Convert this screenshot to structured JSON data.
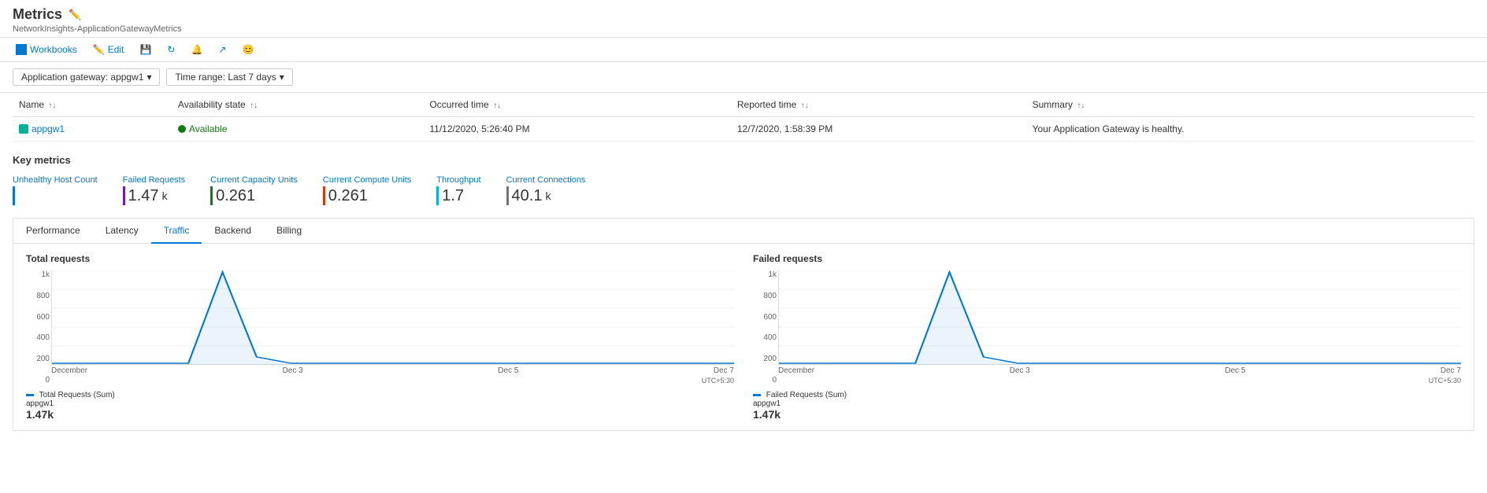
{
  "header": {
    "title": "Metrics",
    "breadcrumb": "NetworkInsights-ApplicationGatewayMetrics",
    "edit_icon": "✏️"
  },
  "toolbar": {
    "workbooks_label": "Workbooks",
    "edit_label": "Edit",
    "save_icon": "💾",
    "refresh_icon": "↻",
    "alert_icon": "🔔",
    "share_icon": "↗",
    "emoji_icon": "😊"
  },
  "filters": {
    "gateway_label": "Application gateway: appgw1",
    "time_range_label": "Time range: Last 7 days"
  },
  "table": {
    "columns": [
      {
        "label": "Name",
        "sort": true
      },
      {
        "label": "Availability state",
        "sort": true
      },
      {
        "label": "Occurred time",
        "sort": true
      },
      {
        "label": "Reported time",
        "sort": true
      },
      {
        "label": "Summary",
        "sort": true
      }
    ],
    "rows": [
      {
        "name": "appgw1",
        "availability": "Available",
        "occurred": "11/12/2020, 5:26:40 PM",
        "reported": "12/7/2020, 1:58:39 PM",
        "summary": "Your Application Gateway is healthy."
      }
    ]
  },
  "key_metrics": {
    "title": "Key metrics",
    "items": [
      {
        "label": "Unhealthy Host Count",
        "value": "",
        "bar_class": "bar-blue"
      },
      {
        "label": "Failed Requests",
        "value": "1.47",
        "suffix": "k",
        "bar_class": "bar-purple"
      },
      {
        "label": "Current Capacity Units",
        "value": "0.261",
        "suffix": "",
        "bar_class": "bar-green"
      },
      {
        "label": "Current Compute Units",
        "value": "0.261",
        "suffix": "",
        "bar_class": "bar-orange"
      },
      {
        "label": "Throughput",
        "value": "1.7",
        "suffix": "",
        "bar_class": "bar-lightblue"
      },
      {
        "label": "Current Connections",
        "value": "40.1",
        "suffix": "k",
        "bar_class": "bar-gray"
      }
    ]
  },
  "tabs": {
    "items": [
      {
        "label": "Performance",
        "active": false
      },
      {
        "label": "Latency",
        "active": false
      },
      {
        "label": "Traffic",
        "active": true
      },
      {
        "label": "Backend",
        "active": false
      },
      {
        "label": "Billing",
        "active": false
      }
    ]
  },
  "charts": {
    "total_requests": {
      "title": "Total requests",
      "y_labels": [
        "1k",
        "800",
        "600",
        "400",
        "200",
        "0"
      ],
      "x_labels": [
        "December",
        "Dec 3",
        "Dec 5",
        "Dec 7"
      ],
      "utc": "UTC+5:30",
      "legend_label": "Total Requests (Sum)",
      "legend_sub": "appgw1",
      "legend_value": "1.47",
      "legend_suffix": "k"
    },
    "failed_requests": {
      "title": "Failed requests",
      "y_labels": [
        "1k",
        "800",
        "600",
        "400",
        "200",
        "0"
      ],
      "x_labels": [
        "December",
        "Dec 3",
        "Dec 5",
        "Dec 7"
      ],
      "utc": "UTC+5:30",
      "legend_label": "Failed Requests (Sum)",
      "legend_sub": "appgw1",
      "legend_value": "1.47",
      "legend_suffix": "k"
    }
  }
}
